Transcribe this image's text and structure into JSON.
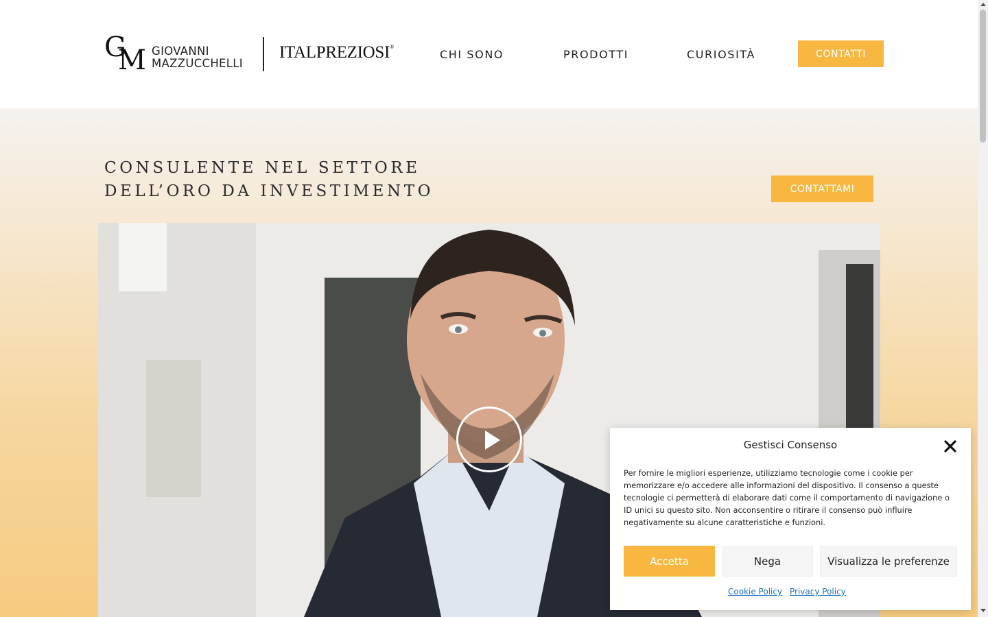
{
  "header": {
    "logo_monogram": "GM",
    "logo_name_line1": "GIOVANNI",
    "logo_name_line2": "MAZZUCCHELLI",
    "brand_name": "ITALPREZIOSI",
    "brand_registered": "®",
    "nav": [
      {
        "label": "CHI SONO"
      },
      {
        "label": "PRODOTTI"
      },
      {
        "label": "CURIOSITÀ"
      }
    ],
    "cta_label": "CONTATTI"
  },
  "hero": {
    "title_line1": "CONSULENTE NEL SETTORE",
    "title_line2": "DELL’ORO DA INVESTIMENTO",
    "cta_label": "CONTATTAMI"
  },
  "cookie": {
    "title": "Gestisci Consenso",
    "text": "Per fornire le migliori esperienze, utilizziamo tecnologie come i cookie per memorizzare e/o accedere alle informazioni del dispositivo. Il consenso a queste tecnologie ci permetterà di elaborare dati come il comportamento di navigazione o ID unici su questo sito. Non acconsentire o ritirare il consenso può influire negativamente su alcune caratteristiche e funzioni.",
    "accept_label": "Accetta",
    "deny_label": "Nega",
    "prefs_label": "Visualizza le preferenze",
    "cookie_policy_label": "Cookie Policy",
    "privacy_policy_label": "Privacy Policy"
  },
  "colors": {
    "accent": "#f7b740",
    "link": "#1e73be"
  }
}
